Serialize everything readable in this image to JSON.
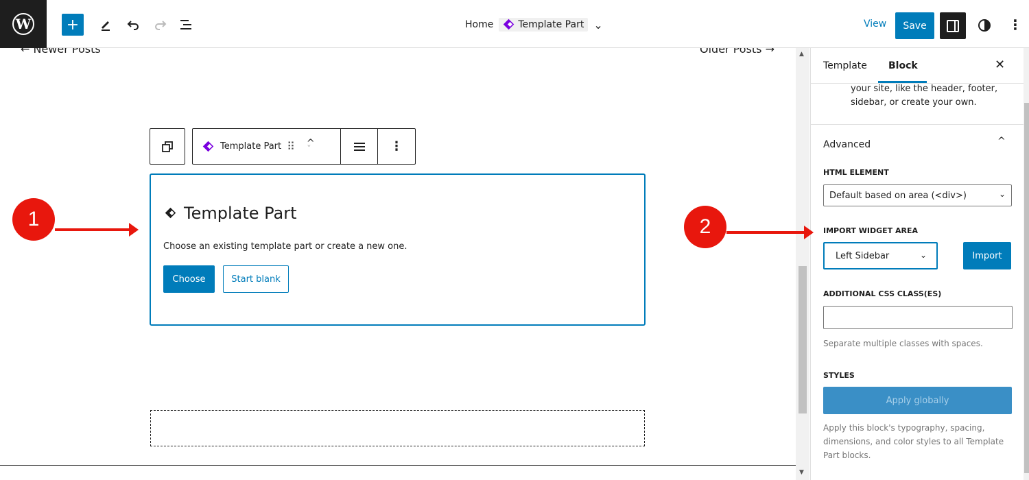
{
  "topbar": {
    "logo": "W",
    "add_icon": "+",
    "tools_icon": "pencil-icon",
    "undo_icon": "undo-icon",
    "redo_icon": "redo-icon",
    "list_view_icon": "list-view-icon",
    "breadcrumb_home": "Home",
    "breadcrumb_current": "Template Part",
    "breadcrumb_chevron": "⌄",
    "view_label": "View",
    "save_label": "Save",
    "more_label": "⋮"
  },
  "canvas": {
    "prev_link": "← Newer Posts",
    "next_link": "Older Posts →",
    "block_toolbar": {
      "block_label": "Template Part",
      "drag": "⠿",
      "move_up": "^",
      "move_down": "ˇ",
      "more": "⋮"
    },
    "placeholder": {
      "title": "Template Part",
      "instructions": "Choose an existing template part or create a new one.",
      "choose_label": "Choose",
      "start_blank_label": "Start blank"
    }
  },
  "sidebar": {
    "tabs": [
      {
        "label": "Template",
        "active": false
      },
      {
        "label": "Block",
        "active": true
      }
    ],
    "close": "✕",
    "description_tail": "your site, like the header, footer, sidebar, or create your own.",
    "advanced": {
      "title": "Advanced",
      "chevron": "^",
      "html_element_label": "HTML ELEMENT",
      "html_element_value": "Default based on area (<div>)",
      "import_widget_label": "IMPORT WIDGET AREA",
      "import_widget_value": "Left Sidebar",
      "import_button": "Import",
      "css_label": "ADDITIONAL CSS CLASS(ES)",
      "css_value": "",
      "css_help": "Separate multiple classes with spaces.",
      "styles_label": "STYLES",
      "apply_globally": "Apply globally",
      "apply_help": "Apply this block's typography, spacing, dimensions, and color styles to all Template Part blocks."
    }
  },
  "annotations": {
    "marker_1": "1",
    "marker_2": "2"
  },
  "colors": {
    "accent": "#007cba",
    "template_part_icon": "#7a00df",
    "annotation": "#e8170d"
  }
}
